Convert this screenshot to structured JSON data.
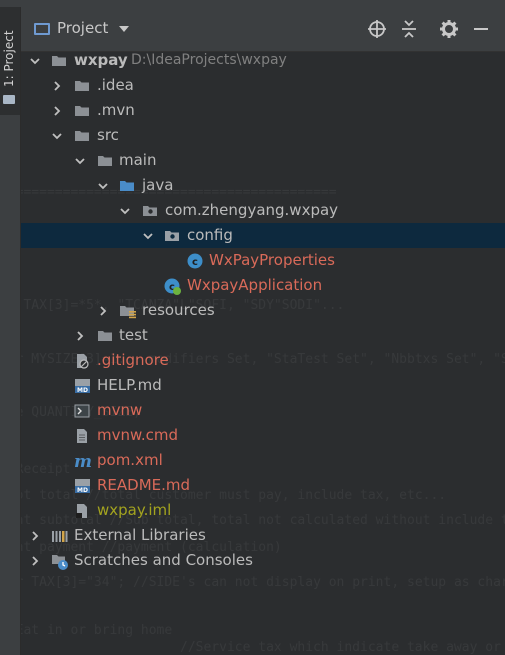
{
  "window": {
    "tool_window_tab": "1: Project",
    "header_title": "Project",
    "accent": "#6f9ad1",
    "selection_bg": "#0d293e"
  },
  "header_icons": [
    "locate-icon",
    "collapse-all-icon",
    "gear-icon",
    "minimize-icon"
  ],
  "tree": {
    "root": {
      "name": "wxpay",
      "path": "D:\\IdeaProjects\\wxpay"
    },
    "idea": ".idea",
    "mvn": ".mvn",
    "src": "src",
    "main": "main",
    "java": "java",
    "package": "com.zhengyang.wxpay",
    "config": "config",
    "wxpayproperties": "WxPayProperties",
    "wxpayapplication": "WxpayApplication",
    "resources": "resources",
    "test": "test",
    "gitignore": ".gitignore",
    "helpmd": "HELP.md",
    "mvnw": "mvnw",
    "mvnwcmd": "mvnw.cmd",
    "pomxml": "pom.xml",
    "readme": "README.md",
    "iml": "wxpay.iml",
    "ext_libs": "External Libraries",
    "scratches": "Scratches and Consoles"
  },
  "colors": {
    "file_modified": "#d96a59",
    "file_ignored": "#a3a31f",
    "folder": "#8c9095",
    "source_folder": "#4a8cc8"
  }
}
